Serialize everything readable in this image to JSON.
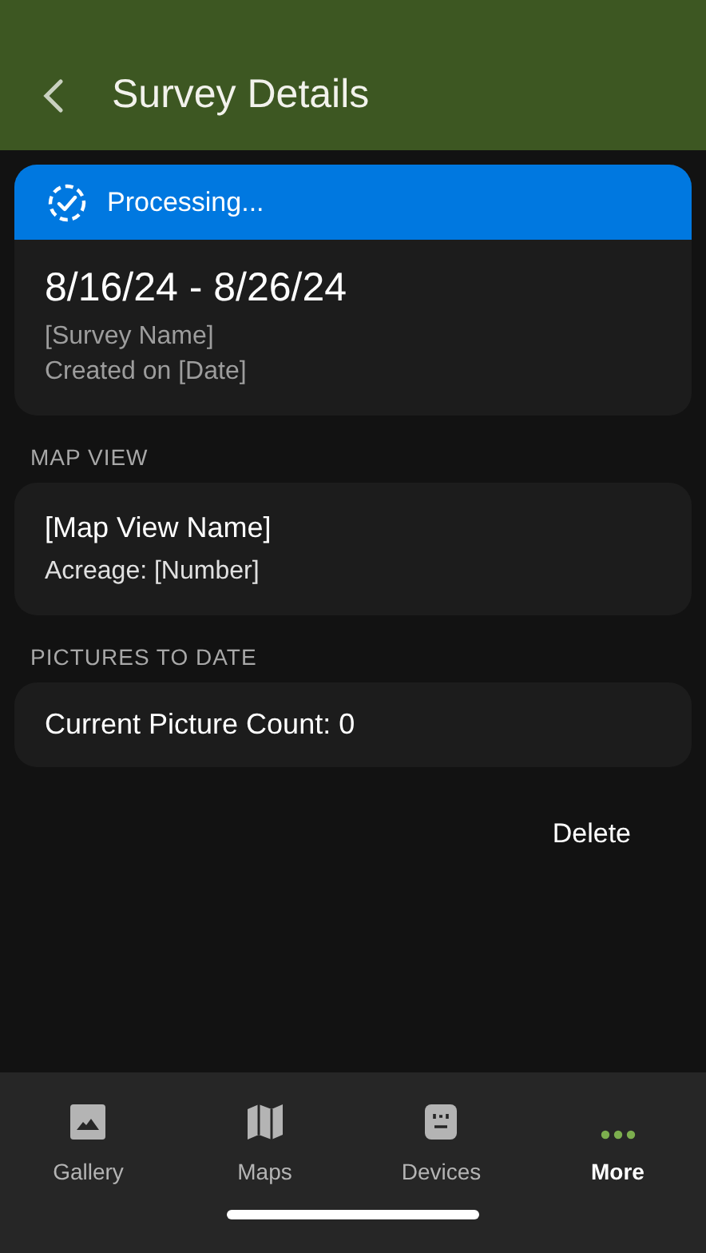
{
  "header": {
    "title": "Survey Details"
  },
  "survey_card": {
    "status": "Processing...",
    "date_range": "8/16/24 - 8/26/24",
    "name": "[Survey Name]",
    "created": "Created on [Date]"
  },
  "map_view": {
    "section_label": "MAP VIEW",
    "name": "[Map View Name]",
    "acreage": "Acreage: [Number]"
  },
  "pictures": {
    "section_label": "PICTURES TO DATE",
    "count": "Current Picture Count: 0"
  },
  "delete_button": "Delete",
  "tabs": [
    {
      "kind": "gallery",
      "label": "Gallery",
      "selected": false
    },
    {
      "kind": "maps",
      "label": "Maps",
      "selected": false
    },
    {
      "kind": "devices",
      "label": "Devices",
      "selected": false
    },
    {
      "kind": "more",
      "label": "More",
      "selected": true
    }
  ]
}
